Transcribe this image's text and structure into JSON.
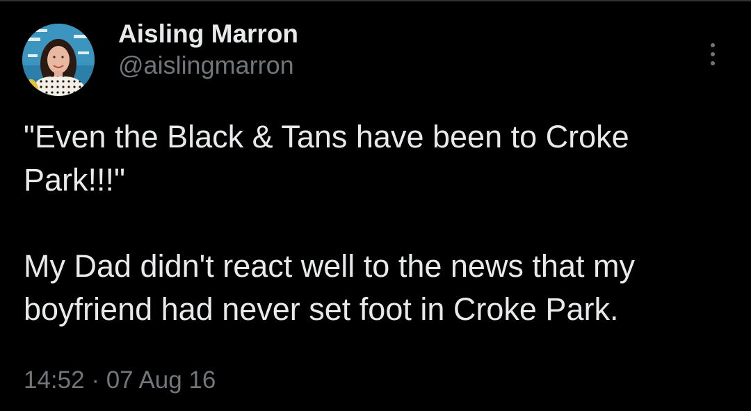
{
  "author": {
    "display_name": "Aisling Marron",
    "handle": "@aislingmarron",
    "avatar_icon": "profile-photo"
  },
  "menu": {
    "icon": "more-options-icon"
  },
  "tweet": {
    "paragraphs": [
      "\"Even the Black & Tans have been to Croke Park!!!\"",
      "My Dad didn't react well to the news that my boyfriend had never set foot in Croke Park."
    ],
    "time": "14:52",
    "separator": "·",
    "date": "07 Aug 16"
  },
  "colors": {
    "background": "#000000",
    "text_primary": "#e7e9ea",
    "text_secondary": "#71767b"
  }
}
